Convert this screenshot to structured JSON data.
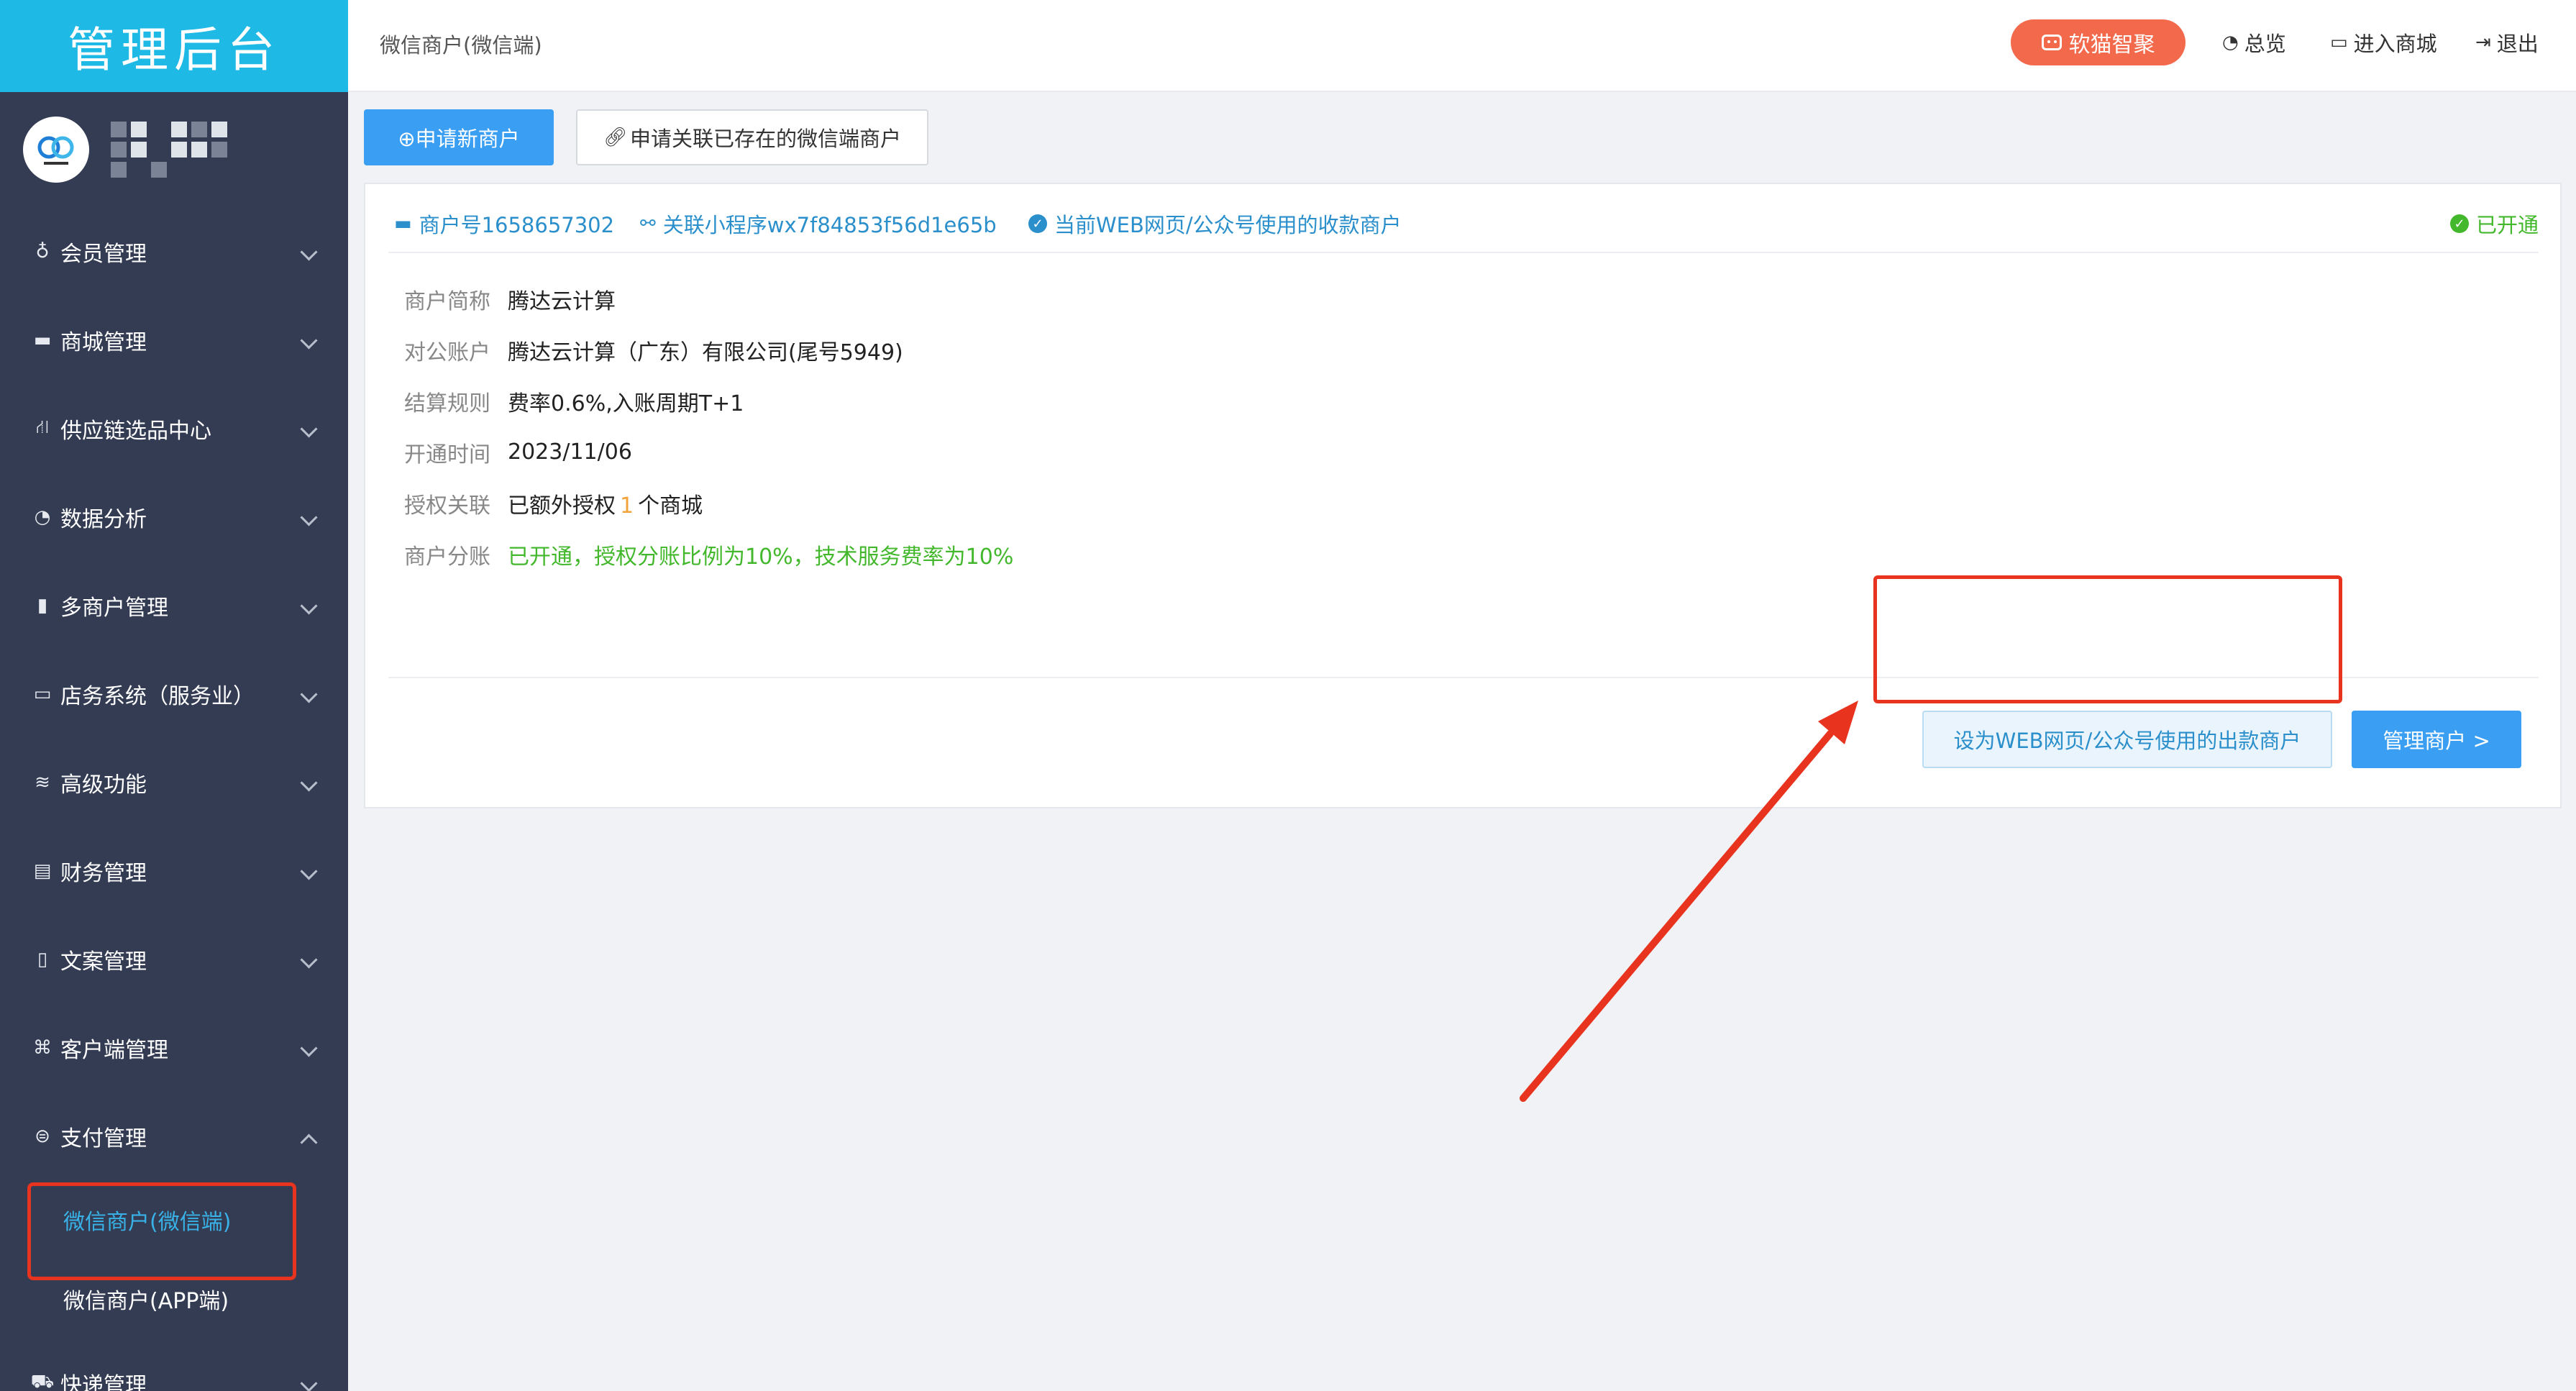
{
  "sidebar": {
    "logo_title": "管理后台",
    "menu": [
      {
        "label": "会员管理",
        "icon": "bulb-icon"
      },
      {
        "label": "商城管理",
        "icon": "store-icon"
      },
      {
        "label": "供应链选品中心",
        "icon": "supply-chain-icon"
      },
      {
        "label": "数据分析",
        "icon": "pie-chart-icon"
      },
      {
        "label": "多商户管理",
        "icon": "bar-chart-icon"
      },
      {
        "label": "店务系统（服务业）",
        "icon": "card-icon"
      },
      {
        "label": "高级功能",
        "icon": "layers-icon"
      },
      {
        "label": "财务管理",
        "icon": "finance-icon"
      },
      {
        "label": "文案管理",
        "icon": "document-icon"
      },
      {
        "label": "客户端管理",
        "icon": "command-icon"
      },
      {
        "label": "支付管理",
        "icon": "payment-icon"
      },
      {
        "label": "快递管理",
        "icon": "truck-icon"
      }
    ],
    "payment_submenu": [
      {
        "label": "微信商户(微信端)",
        "active": true
      },
      {
        "label": "微信商户(APP端)",
        "active": false
      }
    ]
  },
  "header": {
    "breadcrumb": "微信商户(微信端)",
    "ai_button": "软猫智聚",
    "overview": "总览",
    "enter_mall": "进入商城",
    "logout": "退出"
  },
  "actions": {
    "apply_new": "⊕申请新商户",
    "link_existing": "申请关联已存在的微信端商户"
  },
  "merchant": {
    "merchant_no": "商户号1658657302",
    "mini_program": "关联小程序wx7f84853f56d1e65b",
    "current_use": "当前WEB网页/公众号使用的收款商户",
    "status": "已开通",
    "fields": [
      {
        "label": "商户简称",
        "value": "腾达云计算"
      },
      {
        "label": "对公账户",
        "value": "腾达云计算（广东）有限公司(尾号5949)"
      },
      {
        "label": "结算规则",
        "value": "费率0.6%,入账周期T+1"
      },
      {
        "label": "开通时间",
        "value": "2023/11/06"
      }
    ],
    "auth_label": "授权关联",
    "auth_prefix": "已额外授权",
    "auth_count": "1",
    "auth_suffix": "个商城",
    "split_label": "商户分账",
    "split_value": "已开通，授权分账比例为10%，技术服务费率为10%",
    "set_payout_button": "设为WEB网页/公众号使用的出款商户",
    "manage_button": "管理商户 >"
  },
  "colors": {
    "sidebar_bg": "#333c52",
    "logo_bg": "#1fb9e6",
    "primary": "#3a9ef2",
    "success": "#43b82c",
    "highlight": "#e8341f",
    "ai_button": "#f26a4b"
  }
}
